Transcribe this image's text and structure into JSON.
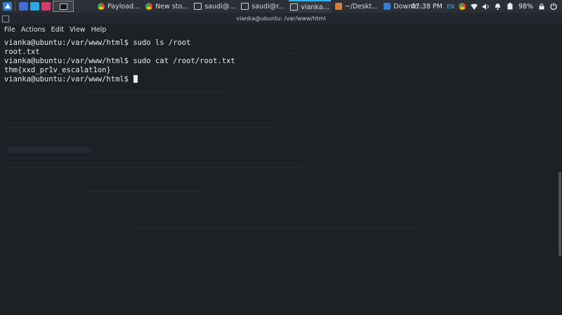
{
  "taskbar": {
    "tasks": [
      {
        "label": "Payload..."
      },
      {
        "label": "New sto..."
      },
      {
        "label": "saudi@..."
      },
      {
        "label": "saudi@r..."
      },
      {
        "label": "vianka..."
      },
      {
        "label": "~/Deskt..."
      },
      {
        "label": "Downlo..."
      }
    ],
    "clock": "07:38 PM",
    "language": "EN",
    "battery": "98%"
  },
  "window": {
    "title": "vianka@ubuntu: /var/www/html",
    "menu": [
      "File",
      "Actions",
      "Edit",
      "View",
      "Help"
    ]
  },
  "terminal": {
    "lines": [
      "vianka@ubuntu:/var/www/html$ sudo ls /root",
      "root.txt",
      "vianka@ubuntu:/var/www/html$ sudo cat /root/root.txt",
      "thm{xxd_pr1v_escalat1on}",
      "vianka@ubuntu:/var/www/html$ "
    ]
  },
  "colors": {
    "background": "#1d2126",
    "text": "#e6e8eb",
    "accent": "#3daee9"
  },
  "icons": [
    "app-menu-icon",
    "desktop-icon",
    "files-icon",
    "browser-icon",
    "chrome-icon",
    "wifi-icon",
    "volume-icon",
    "bell-icon",
    "battery-icon",
    "lock-icon",
    "power-icon"
  ]
}
